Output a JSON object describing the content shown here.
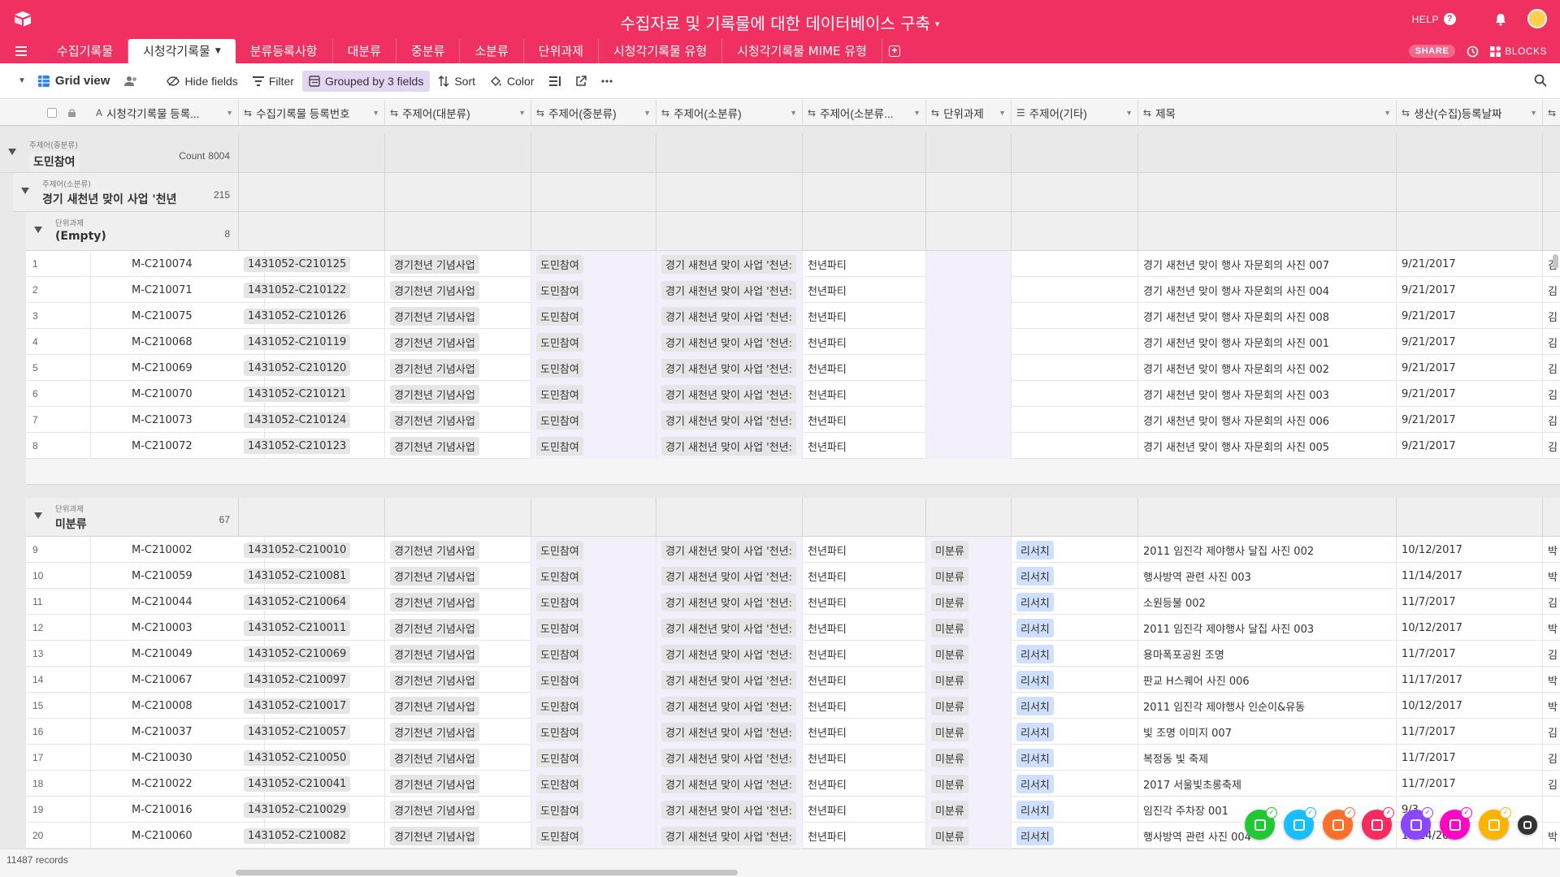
{
  "app": {
    "title": "수집자료 및 기록물에 대한 데이터베이스 구축",
    "caret": "▾",
    "help": "HELP",
    "share": "SHARE",
    "blocks": "BLOCKS",
    "brand_color": "#ef3061"
  },
  "tabs": [
    "수집기록물",
    "시청각기록물",
    "분류등록사항",
    "대분류",
    "중분류",
    "소분류",
    "단위과제",
    "시청각기록물 유형",
    "시청각기록물 MIME 유형"
  ],
  "active_tab": "시청각기록물",
  "toolbar": {
    "view_name": "Grid view",
    "hide_fields": "Hide fields",
    "filter": "Filter",
    "grouped": "Grouped by 3 fields",
    "sort": "Sort",
    "color": "Color"
  },
  "columns": [
    {
      "label": "시청각기록물 등록...",
      "icon": "A"
    },
    {
      "label": "수집기록물 등록번호",
      "icon": "⇆"
    },
    {
      "label": "주제어(대분류)",
      "icon": "⇆"
    },
    {
      "label": "주제어(중분류)",
      "icon": "⇆"
    },
    {
      "label": "주제어(소분류)",
      "icon": "⇆"
    },
    {
      "label": "주제어(소분류...",
      "icon": "⇆"
    },
    {
      "label": "단위과제",
      "icon": "⇆"
    },
    {
      "label": "주제어(기타)",
      "icon": "☰"
    },
    {
      "label": "제목",
      "icon": "⇆"
    },
    {
      "label": "생산(수집)등록날짜",
      "icon": "⇆"
    }
  ],
  "groups": {
    "level1": {
      "label": "주제어(중분류)",
      "value": "도민참여",
      "count_label": "Count",
      "count": "8004"
    },
    "level2": {
      "label": "주제어(소분류)",
      "value": "경기 새천년 맞이 사업 '천년",
      "count": "215"
    },
    "subgroups": [
      {
        "label": "단위과제",
        "value": "(Empty)",
        "count": "8",
        "rows": [
          {
            "n": "1",
            "id": "M-C210074",
            "reg": "1431052-C210125",
            "major": "경기천년 기념사업",
            "mid": "도민참여",
            "minor": "경기 새천년 맞이 사업 '천년:",
            "minor2": "천년파티",
            "unit": "",
            "etc": "",
            "title": "경기 새천년 맞이 행사 자문회의 사진 007",
            "date": "9/21/2017",
            "extra": "김"
          },
          {
            "n": "2",
            "id": "M-C210071",
            "reg": "1431052-C210122",
            "major": "경기천년 기념사업",
            "mid": "도민참여",
            "minor": "경기 새천년 맞이 사업 '천년:",
            "minor2": "천년파티",
            "unit": "",
            "etc": "",
            "title": "경기 새천년 맞이 행사 자문회의 사진 004",
            "date": "9/21/2017",
            "extra": "김"
          },
          {
            "n": "3",
            "id": "M-C210075",
            "reg": "1431052-C210126",
            "major": "경기천년 기념사업",
            "mid": "도민참여",
            "minor": "경기 새천년 맞이 사업 '천년:",
            "minor2": "천년파티",
            "unit": "",
            "etc": "",
            "title": "경기 새천년 맞이 행사 자문회의 사진 008",
            "date": "9/21/2017",
            "extra": "김"
          },
          {
            "n": "4",
            "id": "M-C210068",
            "reg": "1431052-C210119",
            "major": "경기천년 기념사업",
            "mid": "도민참여",
            "minor": "경기 새천년 맞이 사업 '천년:",
            "minor2": "천년파티",
            "unit": "",
            "etc": "",
            "title": "경기 새천년 맞이 행사 자문회의 사진 001",
            "date": "9/21/2017",
            "extra": "김"
          },
          {
            "n": "5",
            "id": "M-C210069",
            "reg": "1431052-C210120",
            "major": "경기천년 기념사업",
            "mid": "도민참여",
            "minor": "경기 새천년 맞이 사업 '천년:",
            "minor2": "천년파티",
            "unit": "",
            "etc": "",
            "title": "경기 새천년 맞이 행사 자문회의 사진 002",
            "date": "9/21/2017",
            "extra": "김"
          },
          {
            "n": "6",
            "id": "M-C210070",
            "reg": "1431052-C210121",
            "major": "경기천년 기념사업",
            "mid": "도민참여",
            "minor": "경기 새천년 맞이 사업 '천년:",
            "minor2": "천년파티",
            "unit": "",
            "etc": "",
            "title": "경기 새천년 맞이 행사 자문회의 사진 003",
            "date": "9/21/2017",
            "extra": "김"
          },
          {
            "n": "7",
            "id": "M-C210073",
            "reg": "1431052-C210124",
            "major": "경기천년 기념사업",
            "mid": "도민참여",
            "minor": "경기 새천년 맞이 사업 '천년:",
            "minor2": "천년파티",
            "unit": "",
            "etc": "",
            "title": "경기 새천년 맞이 행사 자문회의 사진 006",
            "date": "9/21/2017",
            "extra": "김"
          },
          {
            "n": "8",
            "id": "M-C210072",
            "reg": "1431052-C210123",
            "major": "경기천년 기념사업",
            "mid": "도민참여",
            "minor": "경기 새천년 맞이 사업 '천년:",
            "minor2": "천년파티",
            "unit": "",
            "etc": "",
            "title": "경기 새천년 맞이 행사 자문회의 사진 005",
            "date": "9/21/2017",
            "extra": "김"
          }
        ]
      },
      {
        "label": "단위과제",
        "value": "미분류",
        "count": "67",
        "rows": [
          {
            "n": "9",
            "id": "M-C210002",
            "reg": "1431052-C210010",
            "major": "경기천년 기념사업",
            "mid": "도민참여",
            "minor": "경기 새천년 맞이 사업 '천년:",
            "minor2": "천년파티",
            "unit": "미분류",
            "etc": "리서치",
            "title": "2011 임진각 제야행사 달집 사진 002",
            "date": "10/12/2017",
            "extra": "박"
          },
          {
            "n": "10",
            "id": "M-C210059",
            "reg": "1431052-C210081",
            "major": "경기천년 기념사업",
            "mid": "도민참여",
            "minor": "경기 새천년 맞이 사업 '천년:",
            "minor2": "천년파티",
            "unit": "미분류",
            "etc": "리서치",
            "title": "행사방역 관련 사진 003",
            "date": "11/14/2017",
            "extra": "박"
          },
          {
            "n": "11",
            "id": "M-C210044",
            "reg": "1431052-C210064",
            "major": "경기천년 기념사업",
            "mid": "도민참여",
            "minor": "경기 새천년 맞이 사업 '천년:",
            "minor2": "천년파티",
            "unit": "미분류",
            "etc": "리서치",
            "title": "소원등불 002",
            "date": "11/7/2017",
            "extra": "김"
          },
          {
            "n": "12",
            "id": "M-C210003",
            "reg": "1431052-C210011",
            "major": "경기천년 기념사업",
            "mid": "도민참여",
            "minor": "경기 새천년 맞이 사업 '천년:",
            "minor2": "천년파티",
            "unit": "미분류",
            "etc": "리서치",
            "title": "2011 임진각 제야행사 달집 사진 003",
            "date": "10/12/2017",
            "extra": "박"
          },
          {
            "n": "13",
            "id": "M-C210049",
            "reg": "1431052-C210069",
            "major": "경기천년 기념사업",
            "mid": "도민참여",
            "minor": "경기 새천년 맞이 사업 '천년:",
            "minor2": "천년파티",
            "unit": "미분류",
            "etc": "리서치",
            "title": "용마폭포공원 조명",
            "date": "11/7/2017",
            "extra": "김"
          },
          {
            "n": "14",
            "id": "M-C210067",
            "reg": "1431052-C210097",
            "major": "경기천년 기념사업",
            "mid": "도민참여",
            "minor": "경기 새천년 맞이 사업 '천년:",
            "minor2": "천년파티",
            "unit": "미분류",
            "etc": "리서치",
            "title": "판교 H스퀘어 사진 006",
            "date": "11/17/2017",
            "extra": "박"
          },
          {
            "n": "15",
            "id": "M-C210008",
            "reg": "1431052-C210017",
            "major": "경기천년 기념사업",
            "mid": "도민참여",
            "minor": "경기 새천년 맞이 사업 '천년:",
            "minor2": "천년파티",
            "unit": "미분류",
            "etc": "리서치",
            "title": "2011 임진각 제야행사 인순이&유동",
            "date": "10/12/2017",
            "extra": "박"
          },
          {
            "n": "16",
            "id": "M-C210037",
            "reg": "1431052-C210057",
            "major": "경기천년 기념사업",
            "mid": "도민참여",
            "minor": "경기 새천년 맞이 사업 '천년:",
            "minor2": "천년파티",
            "unit": "미분류",
            "etc": "리서치",
            "title": "빛 조명 이미지 007",
            "date": "11/7/2017",
            "extra": "김"
          },
          {
            "n": "17",
            "id": "M-C210030",
            "reg": "1431052-C210050",
            "major": "경기천년 기념사업",
            "mid": "도민참여",
            "minor": "경기 새천년 맞이 사업 '천년:",
            "minor2": "천년파티",
            "unit": "미분류",
            "etc": "리서치",
            "title": "복정동 빛 축제",
            "date": "11/7/2017",
            "extra": "김"
          },
          {
            "n": "18",
            "id": "M-C210022",
            "reg": "1431052-C210041",
            "major": "경기천년 기념사업",
            "mid": "도민참여",
            "minor": "경기 새천년 맞이 사업 '천년:",
            "minor2": "천년파티",
            "unit": "미분류",
            "etc": "리서치",
            "title": "2017 서울빛초롱축제",
            "date": "11/7/2017",
            "extra": "김"
          },
          {
            "n": "19",
            "id": "M-C210016",
            "reg": "1431052-C210029",
            "major": "경기천년 기념사업",
            "mid": "도민참여",
            "minor": "경기 새천년 맞이 사업 '천년:",
            "minor2": "천년파티",
            "unit": "미분류",
            "etc": "리서치",
            "title": "임진각 주차장 001",
            "date": "9/3...",
            "extra": ""
          },
          {
            "n": "20",
            "id": "M-C210060",
            "reg": "1431052-C210082",
            "major": "경기천년 기념사업",
            "mid": "도민참여",
            "minor": "경기 새천년 맞이 사업 '천년:",
            "minor2": "천년파티",
            "unit": "미분류",
            "etc": "리서치",
            "title": "행사방역 관련 사진 004",
            "date": "11/14/2017",
            "extra": "박"
          }
        ]
      }
    ]
  },
  "footer": {
    "records": "11487 records"
  },
  "floating_apps": [
    {
      "name": "green-app",
      "color": "#20c933"
    },
    {
      "name": "cyan-app",
      "color": "#18bfff"
    },
    {
      "name": "orange-app",
      "color": "#ff6f2c"
    },
    {
      "name": "red-app",
      "color": "#f82b60"
    },
    {
      "name": "purple-app",
      "color": "#8b46ff"
    },
    {
      "name": "magenta-app",
      "color": "#ff08c2"
    },
    {
      "name": "yellow-app",
      "color": "#fcb400"
    },
    {
      "name": "expand-app",
      "color": "#333333"
    }
  ]
}
